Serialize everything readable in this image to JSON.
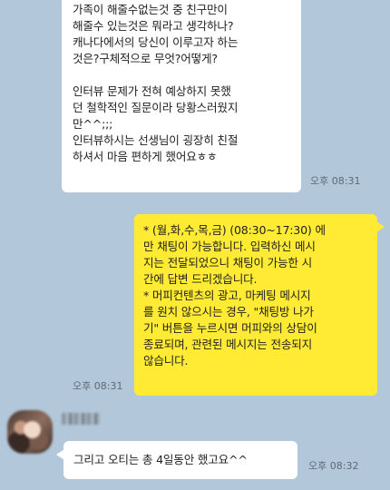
{
  "messages": [
    {
      "direction": "incoming",
      "lines": [
        "가족이 해줄수없는것 중 친구만이",
        "해줄수 있는것은 뭐라고 생각하나?",
        "캐나다에서의 당신이 이루고자 하는",
        "것은?구체적으로 무엇?어떻게?",
        "",
        "인터뷰 문제가 전혀 예상하지 못했",
        "던 철학적인 질문이라 당황스러웠지",
        "만^^;;;",
        "인터뷰하시는 선생님이 굉장히 친절",
        "하셔서 마음 편하게 했어요ㅎㅎ"
      ],
      "time": "오후 08:31"
    },
    {
      "direction": "outgoing",
      "lines": [
        " * (월,화,수,목,금) (08:30~17:30) 에",
        "만 채팅이 가능합니다. 입력하신 메시",
        "지는 전달되었으니 채팅이 가능한 시",
        "간에 답변 드리겠습니다.",
        " * 머피컨텐츠의 광고, 마케팅 메시지",
        "를 원치 않으시는 경우, \"채팅방 나가",
        "기\" 버튼을 누르시면 머피와의 상담이",
        "종료되며, 관련된 메시지는 전송되지",
        "않습니다."
      ],
      "time": "오후 08:31"
    },
    {
      "direction": "incoming",
      "lines": [
        "그리고 오티는 총 4일동안 했고요^^"
      ],
      "time": "오후 08:32"
    }
  ],
  "colors": {
    "chat_background": "#b2c7d9",
    "incoming_bubble": "#ffffff",
    "outgoing_bubble": "#ffeb33"
  }
}
